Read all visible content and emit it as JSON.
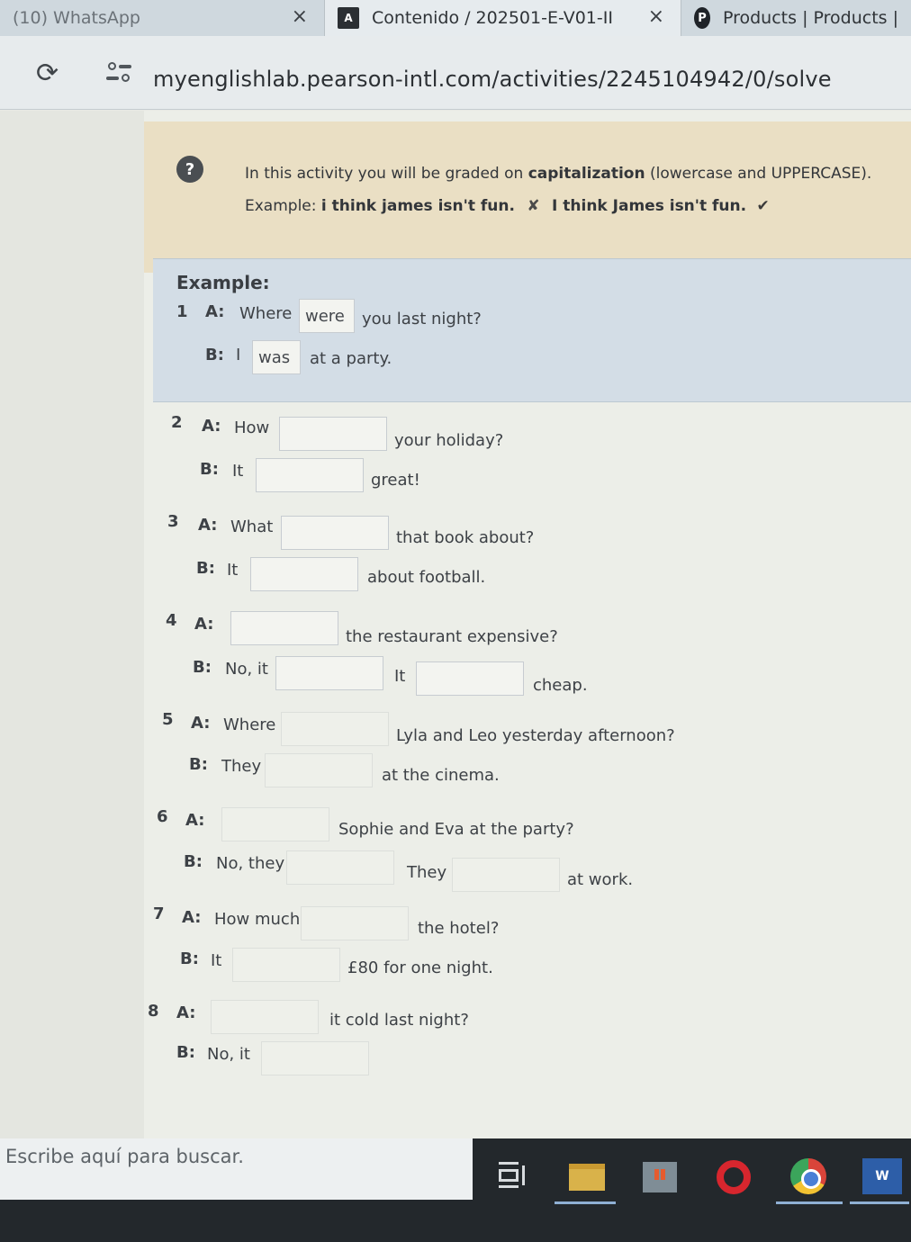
{
  "browser": {
    "tabs": [
      {
        "label": "(10) WhatsApp",
        "icon": "whatsapp-icon"
      },
      {
        "label": "Contenido / 202501-E-V01-II",
        "icon": "pearson-icon",
        "favicon_text": "A"
      },
      {
        "label": "Products | Products |",
        "icon": "products-icon",
        "favicon_text": "P"
      }
    ],
    "close_glyph": "×",
    "url": "myenglishlab.pearson-intl.com/activities/2245104942/0/solve"
  },
  "notice": {
    "help_glyph": "?",
    "line1_pre": "In this activity you will be graded on ",
    "line1_bold": "capitalization",
    "line1_post": " (lowercase and UPPERCASE).",
    "example_label": "Example:",
    "bad_example": "i think james isn't fun.",
    "good_example": "I think James isn't fun.",
    "x_glyph": "✘",
    "check_glyph": "✔"
  },
  "example": {
    "title": "Example:",
    "num": "1",
    "a_label": "A:",
    "a_pre": "Where",
    "a_answer": "were",
    "a_post": "you last night?",
    "b_label": "B:",
    "b_pre": "I",
    "b_answer": "was",
    "b_post": "at a party."
  },
  "items": {
    "q2": {
      "num": "2",
      "a_label": "A:",
      "a_pre": "How",
      "a_post": "your holiday?",
      "b_label": "B:",
      "b_pre": "It",
      "b_post": "great!"
    },
    "q3": {
      "num": "3",
      "a_label": "A:",
      "a_pre": "What",
      "a_post": "that book about?",
      "b_label": "B:",
      "b_pre": "It",
      "b_post": "about football."
    },
    "q4": {
      "num": "4",
      "a_label": "A:",
      "a_post": "the restaurant expensive?",
      "b_label": "B:",
      "b_pre": "No, it",
      "b_mid": "It",
      "b_post": "cheap."
    },
    "q5": {
      "num": "5",
      "a_label": "A:",
      "a_pre": "Where",
      "a_post": "Lyla and Leo yesterday afternoon?",
      "b_label": "B:",
      "b_pre": "They",
      "b_post": "at the cinema."
    },
    "q6": {
      "num": "6",
      "a_label": "A:",
      "a_post": "Sophie and Eva at the party?",
      "b_label": "B:",
      "b_pre": "No, they",
      "b_mid": "They",
      "b_post": "at work."
    },
    "q7": {
      "num": "7",
      "a_label": "A:",
      "a_pre": "How much",
      "a_post": "the hotel?",
      "b_label": "B:",
      "b_pre": "It",
      "b_post": "£80 for one night."
    },
    "q8": {
      "num": "8",
      "a_label": "A:",
      "a_post": "it cold last night?",
      "b_label": "B:",
      "b_pre": "No, it"
    }
  },
  "taskbar": {
    "search_placeholder": "Escribe aquí para buscar.",
    "apps": [
      "task-view-icon",
      "file-explorer-icon",
      "store-icon",
      "opera-icon",
      "chrome-icon",
      "word-icon"
    ],
    "word_glyph": "W"
  }
}
